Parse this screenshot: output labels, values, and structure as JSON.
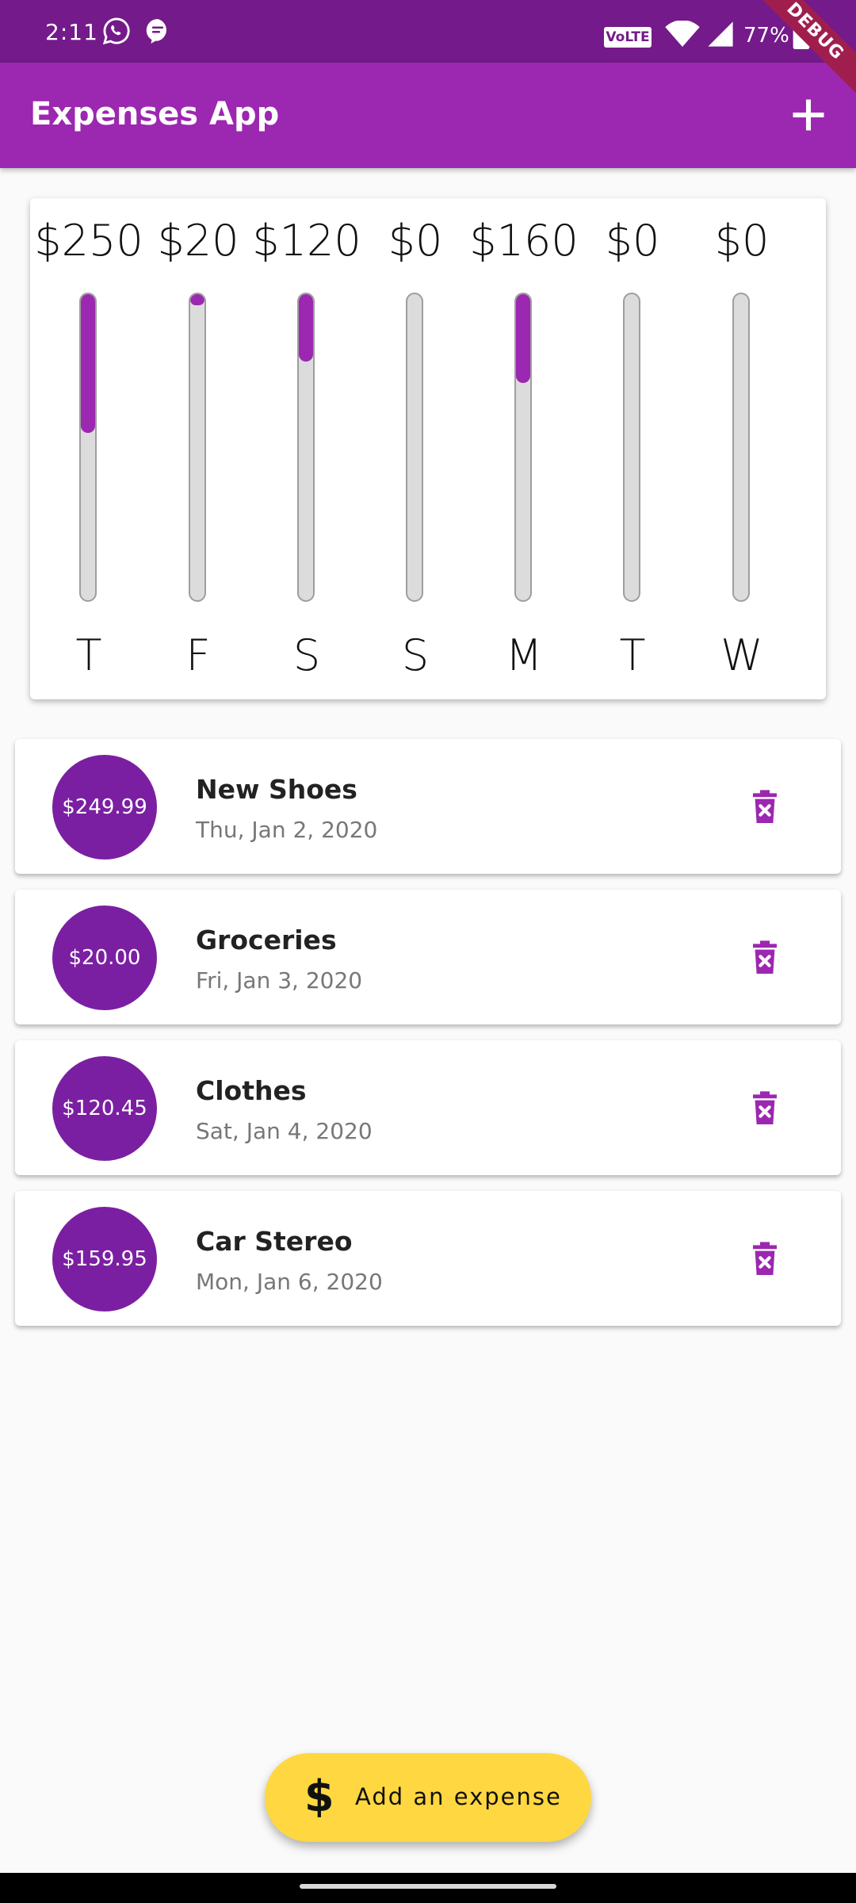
{
  "status_bar": {
    "time": "2:11",
    "volte": "VoLTE",
    "battery": "77%"
  },
  "debug_banner": "DEBUG",
  "app_bar": {
    "title": "Expenses App",
    "add_icon": "plus-icon"
  },
  "chart_data": {
    "type": "bar",
    "categories": [
      "T",
      "F",
      "S",
      "S",
      "M",
      "T",
      "W"
    ],
    "value_labels": [
      "$250",
      "$20",
      "$120",
      "$0",
      "$160",
      "$0",
      "$0"
    ],
    "values": [
      249.99,
      20.0,
      120.45,
      0,
      159.95,
      0,
      0
    ],
    "fill_fractions": [
      0.4546,
      0.0364,
      0.219,
      0,
      0.2908,
      0,
      0
    ],
    "orientation": "vertical",
    "bar_color": "#9c27b0",
    "track_color": "#dcdcdc"
  },
  "transactions": [
    {
      "amount": "$249.99",
      "title": "New Shoes",
      "date": "Thu, Jan 2, 2020"
    },
    {
      "amount": "$20.00",
      "title": "Groceries",
      "date": "Fri, Jan 3, 2020"
    },
    {
      "amount": "$120.45",
      "title": "Clothes",
      "date": "Sat, Jan 4, 2020"
    },
    {
      "amount": "$159.95",
      "title": "Car Stereo",
      "date": "Mon, Jan 6, 2020"
    }
  ],
  "fab": {
    "icon": "$",
    "label": "Add an expense"
  },
  "colors": {
    "primary": "#9c27b0",
    "primary_dark": "#741a8a",
    "accent": "#ffd740",
    "amount_circle": "#7b1fa2"
  }
}
